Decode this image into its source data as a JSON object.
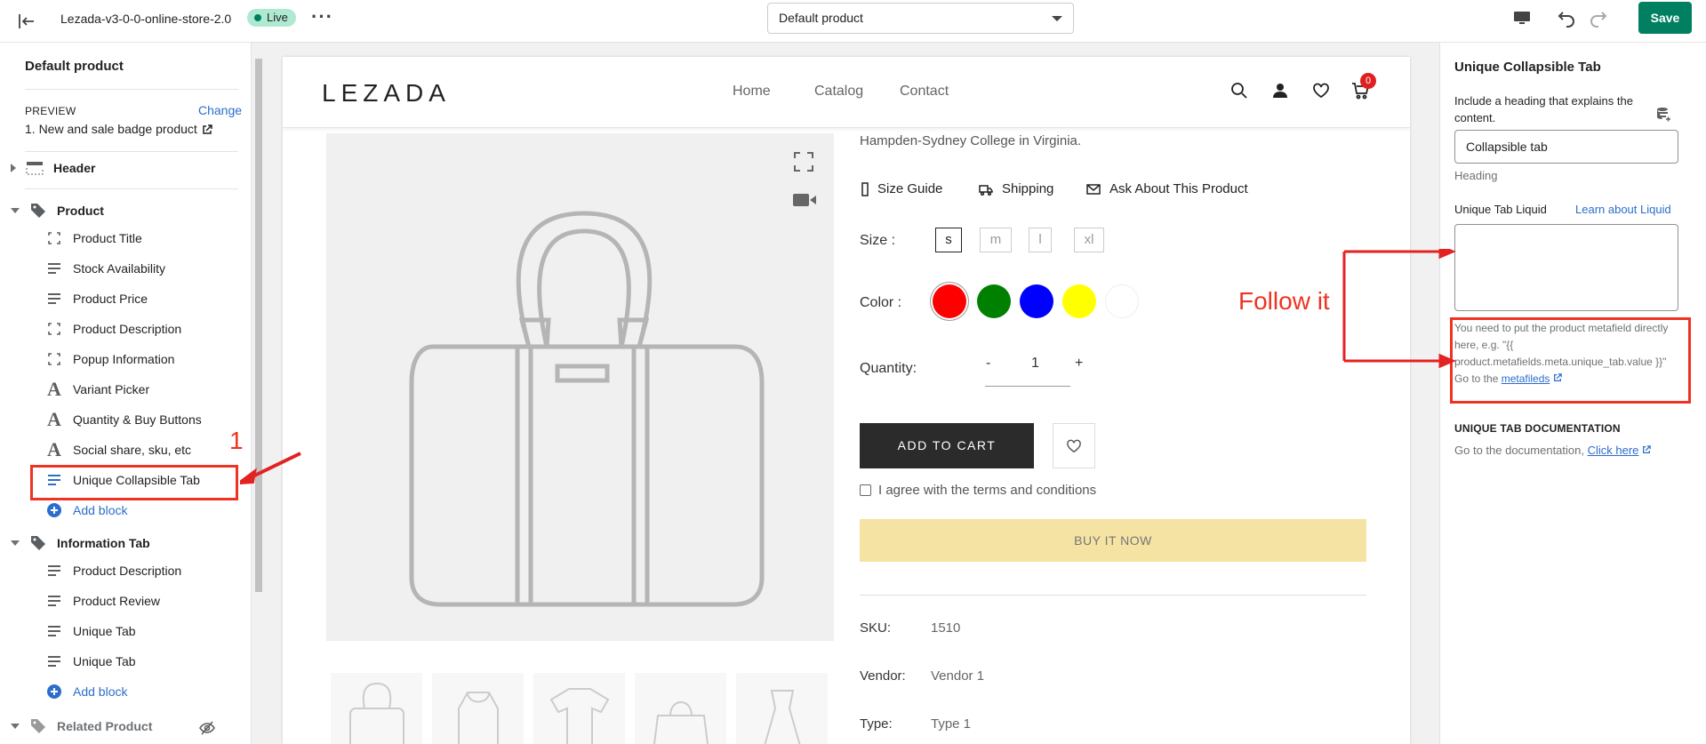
{
  "topbar": {
    "store_name": "Lezada-v3-0-0-online-store-2.0",
    "live": "Live",
    "template_select": "Default product",
    "save": "Save"
  },
  "left": {
    "title": "Default product",
    "preview_label": "PREVIEW",
    "change": "Change",
    "preview_product": "1. New and sale badge product",
    "sections": {
      "header": "Header",
      "product": "Product",
      "information_tab": "Information Tab",
      "related": "Related Product"
    },
    "product_blocks": [
      "Product Title",
      "Stock Availability",
      "Product Price",
      "Product Description",
      "Popup Information",
      "Variant Picker",
      "Quantity & Buy Buttons",
      "Social share, sku, etc",
      "Unique Collapsible Tab"
    ],
    "info_blocks": [
      "Product Description",
      "Product Review",
      "Unique Tab",
      "Unique Tab"
    ],
    "add_block": "Add block"
  },
  "preview": {
    "logo": "LEZADA",
    "nav": [
      "Home",
      "Catalog",
      "Contact"
    ],
    "cart_count": "0",
    "desc_line": "Hampden-Sydney College in Virginia.",
    "links": [
      "Size Guide",
      "Shipping",
      "Ask About This Product"
    ],
    "size_label": "Size :",
    "sizes": [
      "s",
      "m",
      "l",
      "xl"
    ],
    "color_label": "Color :",
    "colors": [
      "#ff0000",
      "#008000",
      "#0000ff",
      "#ffff00",
      "#ffffff"
    ],
    "qty_label": "Quantity:",
    "qty_minus": "-",
    "qty_value": "1",
    "qty_plus": "+",
    "add_to_cart": "ADD TO CART",
    "agree": "I agree with the terms and conditions",
    "buy_now": "BUY IT NOW",
    "sku_label": "SKU:",
    "sku": "1510",
    "vendor_label": "Vendor:",
    "vendor": "Vendor 1",
    "type_label": "Type:",
    "type": "Type 1"
  },
  "right": {
    "title": "Unique Collapsible Tab",
    "heading_help": "Include a heading that explains the content.",
    "heading_value": "Collapsible tab",
    "heading_label": "Heading",
    "liquid_label": "Unique Tab Liquid",
    "liquid_link": "Learn about Liquid",
    "help_text": "You need to put the product metafield directly here, e.g. \"{{ product.metafields.meta.unique_tab.value }}\" Go to the ",
    "help_link": "metafileds",
    "doc_heading": "UNIQUE TAB DOCUMENTATION",
    "doc_text": "Go to the documentation, ",
    "doc_link": "Click here"
  },
  "annotations": {
    "number": "1",
    "follow": "Follow it",
    "color": "#e32222"
  }
}
